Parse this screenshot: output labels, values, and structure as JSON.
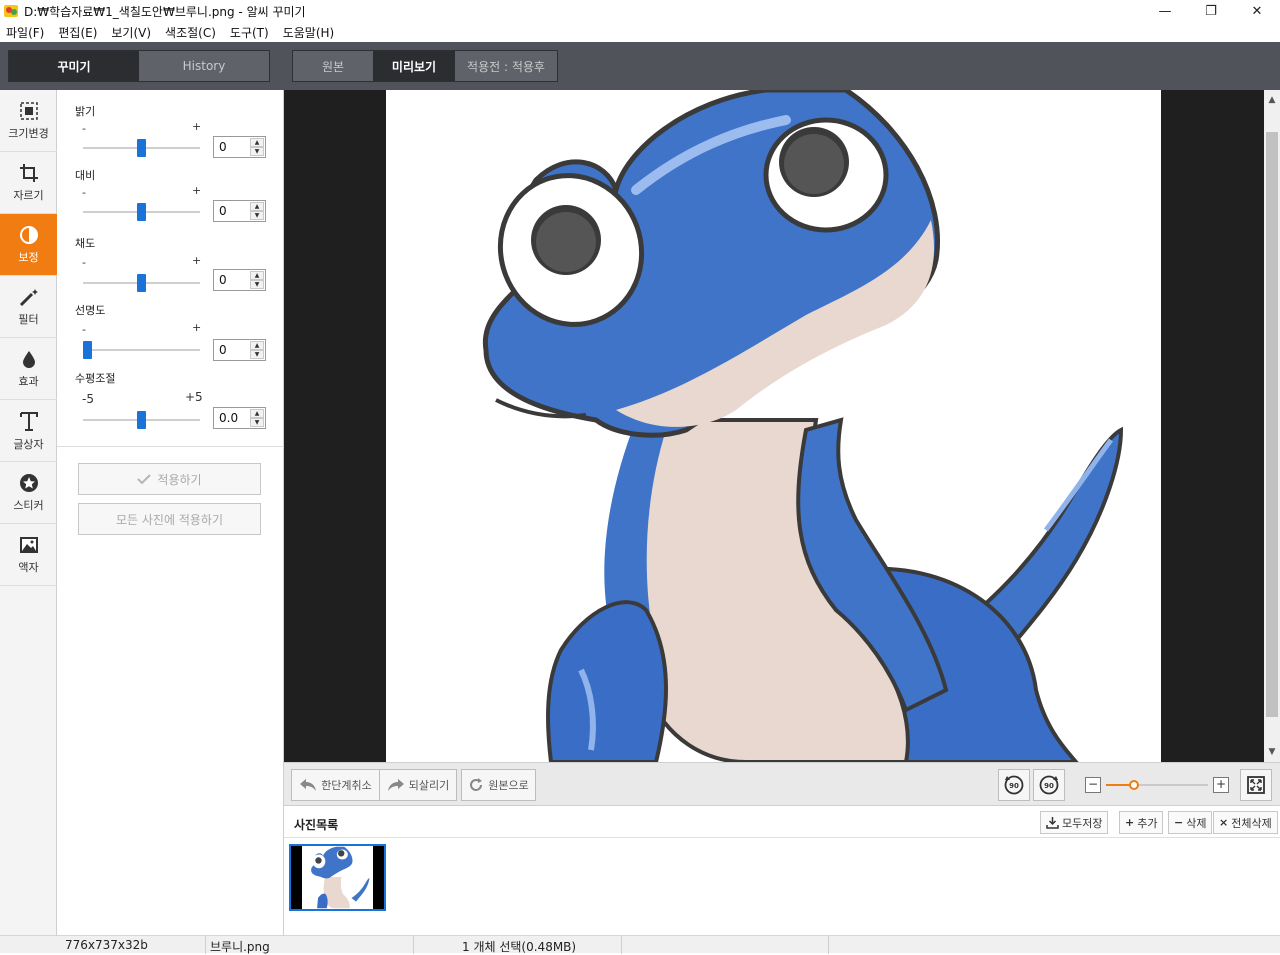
{
  "window": {
    "title": "D:₩학습자료₩1_색칠도안₩브루니.png - 알씨 꾸미기",
    "minimize": "—",
    "restore": "❐",
    "close": "✕"
  },
  "menu": [
    "파일(F)",
    "편집(E)",
    "보기(V)",
    "색조절(C)",
    "도구(T)",
    "도움말(H)"
  ],
  "left_tabs": {
    "active": "꾸미기",
    "inactive": "History"
  },
  "view_tabs": [
    "원본",
    "미리보기",
    "적용전 : 적용후"
  ],
  "view_tab_active": "미리보기",
  "sidebar": [
    {
      "label": "크기변경",
      "icon": "resize-icon"
    },
    {
      "label": "자르기",
      "icon": "crop-icon"
    },
    {
      "label": "보정",
      "icon": "contrast-icon",
      "active": true
    },
    {
      "label": "필터",
      "icon": "magic-wand-icon"
    },
    {
      "label": "효과",
      "icon": "drop-icon"
    },
    {
      "label": "글상자",
      "icon": "text-icon"
    },
    {
      "label": "스티커",
      "icon": "star-badge-icon"
    },
    {
      "label": "액자",
      "icon": "picture-frame-icon"
    }
  ],
  "adjustments": [
    {
      "label": "밝기",
      "min": "-",
      "max": "+",
      "value": "0",
      "level": 0.5
    },
    {
      "label": "대비",
      "min": "-",
      "max": "+",
      "value": "0",
      "level": 0.5
    },
    {
      "label": "채도",
      "min": "-",
      "max": "+",
      "value": "0",
      "level": 0.5
    },
    {
      "label": "선명도",
      "min": "-",
      "max": "+",
      "value": "0",
      "level": 0.0
    },
    {
      "label": "수평조절",
      "min": "-5",
      "max": "+5",
      "value": "0.0",
      "level": 0.5
    }
  ],
  "buttons": {
    "apply": "적용하기",
    "apply_all": "모든 사진에 적용하기",
    "undo": "한단계취소",
    "redo": "되살리기",
    "original": "원본으로",
    "rotate_left": "90",
    "rotate_right": "90"
  },
  "zoom": {
    "level": 0.25
  },
  "photo_list": {
    "title": "사진목록",
    "save_all": "모두저장",
    "add": "추가",
    "delete": "삭제",
    "delete_all": "전체삭제"
  },
  "status": {
    "dimensions": "776x737x32b",
    "filename": "브루니.png",
    "selection": "1 개체 선택(0.48MB)"
  },
  "colors": {
    "accent": "#f07c12",
    "slider": "#1a73d9",
    "toolbar": "#505359"
  }
}
